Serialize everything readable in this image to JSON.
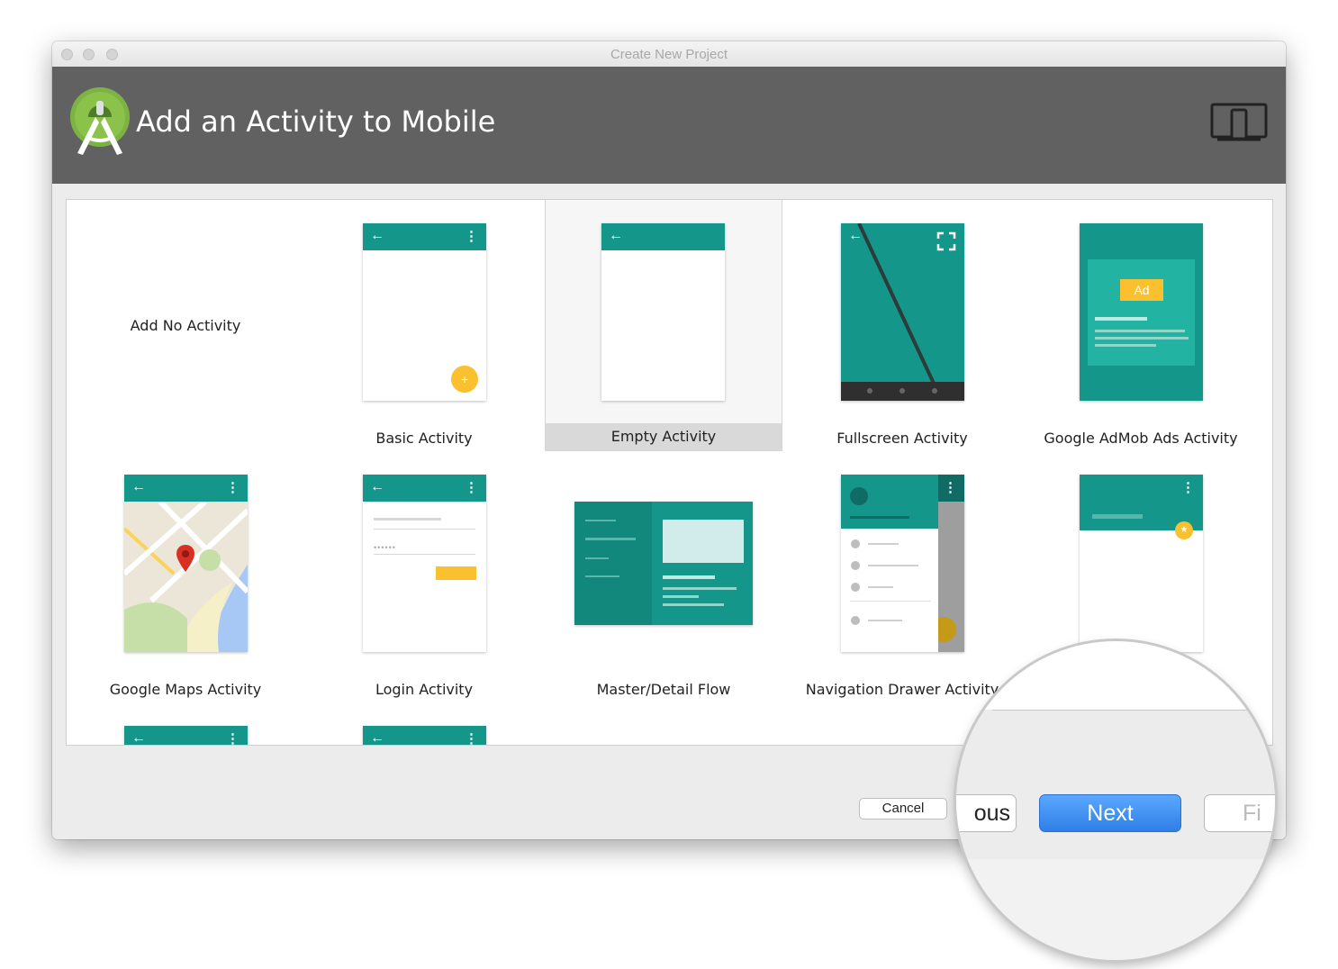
{
  "window": {
    "title": "Create New Project"
  },
  "header": {
    "title": "Add an Activity to Mobile"
  },
  "activities": [
    {
      "label": "Add No Activity"
    },
    {
      "label": "Basic Activity"
    },
    {
      "label": "Empty Activity",
      "selected": true
    },
    {
      "label": "Fullscreen Activity"
    },
    {
      "label": "Google AdMob Ads Activity"
    },
    {
      "label": "Google Maps Activity"
    },
    {
      "label": "Login Activity"
    },
    {
      "label": "Master/Detail Flow"
    },
    {
      "label": "Navigation Drawer Activity"
    }
  ],
  "admob": {
    "badge": "Ad"
  },
  "buttons": {
    "cancel": "Cancel",
    "previous_partial": "ous",
    "next": "Next",
    "finish_partial": "Fi"
  },
  "colors": {
    "accent_teal": "#15968a",
    "fab_yellow": "#fbc02d",
    "header_gray": "#616161",
    "next_blue": "#3d8ef0"
  },
  "icons": [
    "android-studio-logo-icon",
    "device-form-factor-icon",
    "back-arrow-icon",
    "overflow-menu-icon",
    "fab-icon",
    "fullscreen-icon",
    "map-pin-icon"
  ]
}
